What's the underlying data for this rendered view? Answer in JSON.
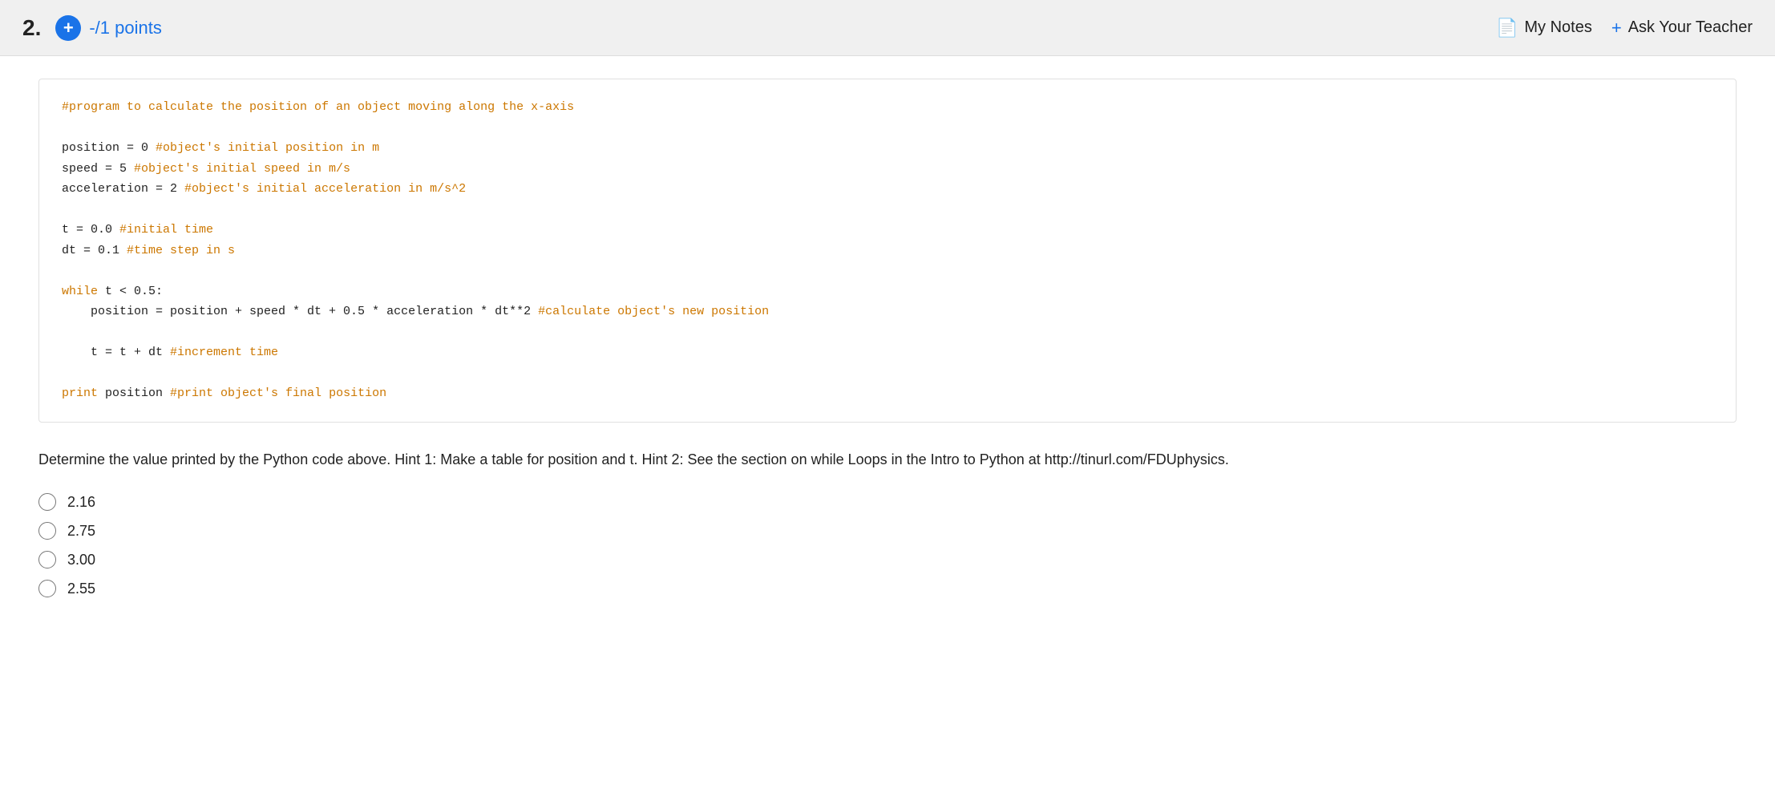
{
  "header": {
    "question_number": "2.",
    "plus_icon": "+",
    "points_label": "-/1 points",
    "my_notes_icon": "📄",
    "my_notes_label": "My Notes",
    "ask_teacher_icon": "+",
    "ask_teacher_label": "Ask Your Teacher"
  },
  "code": {
    "line1_comment": "#program to calculate the position of an object moving along the x-axis",
    "line2": "position = 0 ",
    "line2_comment": "#object's initial position in m",
    "line3": "speed = 5 ",
    "line3_comment": "#object's initial speed in m/s",
    "line4": "acceleration = 2 ",
    "line4_comment": "#object's initial acceleration in m/s^2",
    "line5": "t = 0.0 ",
    "line5_comment": "#initial time",
    "line6": "dt = 0.1 ",
    "line6_comment": "#time step in s",
    "line7_kw": "while",
    "line7": " t < 0.5:",
    "line8": "    position = position + speed * dt + 0.5 * acceleration * dt**2 ",
    "line8_comment": "#calculate object's new position",
    "line9": "    t = t + dt ",
    "line9_comment": "#increment time",
    "line10_kw": "print",
    "line10": " position ",
    "line10_comment": "#print object's final position"
  },
  "question": {
    "text": "Determine the value printed by the Python code above. Hint 1: Make a table for position and t. Hint 2: See the section on while Loops in the Intro to Python at http://tinurl.com/FDUphysics."
  },
  "options": [
    {
      "value": "2.16",
      "label": "2.16"
    },
    {
      "value": "2.75",
      "label": "2.75"
    },
    {
      "value": "3.00",
      "label": "3.00"
    },
    {
      "value": "2.55",
      "label": "2.55"
    }
  ],
  "colors": {
    "accent": "#1a73e8",
    "comment_orange": "#cc7700",
    "code_dark": "#222222"
  }
}
